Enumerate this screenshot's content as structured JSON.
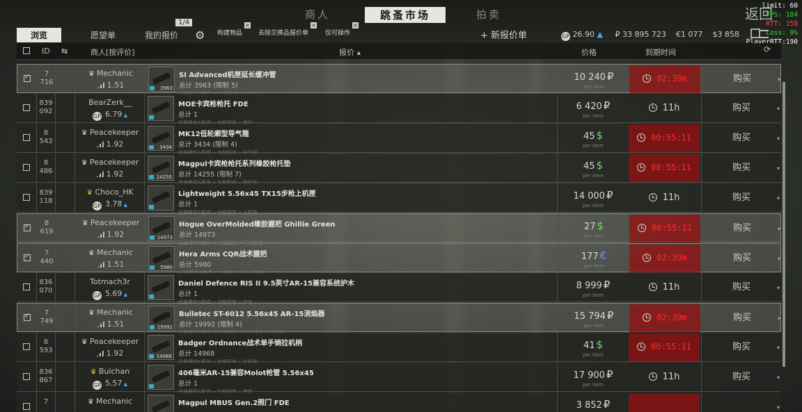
{
  "tabs": {
    "traders": "商人",
    "flea": "跳蚤市场",
    "auction": "拍卖"
  },
  "back": "返回",
  "debug": {
    "limit": "limit: 60",
    "fps": "FPS: 184",
    "rtt": "RTT: 158",
    "loss": "Loss: 0%",
    "player": "PlayerRTT:190"
  },
  "subtabs": {
    "browse": "浏览",
    "wishlist": "愿望单",
    "myoffers": "我的报价",
    "page": "1/4"
  },
  "filters": {
    "build": "构建物品",
    "barter": "去除交换品报价单",
    "only": "仅可操作"
  },
  "add_offer": "+ 新报价单",
  "currency": {
    "gp": "26.90",
    "rub": "₽ 33 895 723",
    "eur": "€1 077",
    "usd": "$3 858"
  },
  "header": {
    "id": "ID",
    "seller": "商人[按评价]",
    "offer": "报价",
    "price": "价格",
    "expires": "到期时间"
  },
  "rows": [
    {
      "selected": true,
      "checked": true,
      "id1": "7",
      "id2": "716",
      "seller": "Mechanic",
      "icon": "trader",
      "rating": "1.51",
      "item": "SI Advanced机匣延长缓冲管",
      "total": "总计 3963 (限制 5)",
      "cat": "武器零件&配件 » 功能配件 » 枪机机匣",
      "qty": "3963",
      "price": "10 240",
      "cur": "rub",
      "per": "per item",
      "time": "02:39m",
      "expiring": true,
      "buy": "购买"
    },
    {
      "selected": false,
      "checked": false,
      "id1": "839",
      "id2": "092",
      "seller": "BearZerk__",
      "icon": "gp",
      "rating": "6.79",
      "up": true,
      "item": "MOE卡宾枪枪托 FDE",
      "total": "总计 1",
      "cat": "武器零件&配件 » 功能配件 » 枪托",
      "qty": "",
      "price": "6 420",
      "cur": "rub",
      "per": "per item",
      "time": "11h",
      "expiring": false,
      "buy": "购买"
    },
    {
      "selected": false,
      "checked": false,
      "id1": "8",
      "id2": "543",
      "seller": "Peacekeeper",
      "icon": "trader",
      "rating": "1.92",
      "item": "MK12低轮廓型导气箍",
      "total": "总计 3434 (限制 4)",
      "cat": "武器零件&配件 » 功能配件 » 导气箍",
      "qty": "3434",
      "price": "45",
      "cur": "usd",
      "per": "per item",
      "time": "00:55:11",
      "expiring": true,
      "buy": "购买"
    },
    {
      "selected": false,
      "checked": false,
      "id1": "8",
      "id2": "486",
      "seller": "Peacekeeper",
      "icon": "trader",
      "rating": "1.92",
      "item": "Magpul卡宾枪枪托系列橡胶枪托垫",
      "total": "总计 14255 (限制 7)",
      "cat": "武器零件&配件 » 功能配件 » 枪托垫",
      "qty": "14255",
      "price": "45",
      "cur": "usd",
      "per": "per item",
      "time": "00:55:11",
      "expiring": true,
      "buy": "购买"
    },
    {
      "selected": false,
      "checked": false,
      "id1": "839",
      "id2": "118",
      "seller": "Choco_HK",
      "icon": "gp",
      "crown": true,
      "rating": "3.78",
      "up": true,
      "item": "Lightweight 5.56x45 TX15步枪上机匣",
      "total": "总计 1",
      "cat": "武器零件&配件 » 功能配件 » 上机匣",
      "qty": "",
      "price": "14 000",
      "cur": "rub",
      "per": "per item",
      "time": "11h",
      "expiring": false,
      "buy": "购买"
    },
    {
      "selected": true,
      "checked": true,
      "id1": "8",
      "id2": "619",
      "seller": "Peacekeeper",
      "icon": "trader",
      "rating": "1.92",
      "item": "Hogue OverMolded橡胶握把 Ghillie Green",
      "total": "总计 14973",
      "cat": "武器零件&配件 » 功能配件 » 手枪握把",
      "qty": "14973",
      "price": "27",
      "cur": "usd",
      "per": "per item",
      "time": "00:55:11",
      "expiring": true,
      "buy": "购买"
    },
    {
      "selected": true,
      "checked": true,
      "id1": "7",
      "id2": "440",
      "seller": "Mechanic",
      "icon": "trader",
      "rating": "1.51",
      "item": "Hera Arms CQR战术握把",
      "total": "总计 5980",
      "cat": "武器零件&配件 » 功能配件 » 战术握把",
      "qty": "5980",
      "price": "177",
      "cur": "eur",
      "per": "per item",
      "time": "02:39m",
      "expiring": true,
      "buy": "购买"
    },
    {
      "selected": false,
      "checked": false,
      "id1": "836",
      "id2": "070",
      "seller": "Totmach3r",
      "icon": "gp",
      "rating": "5.69",
      "up": true,
      "item": "Daniel Defence RIS II 9.5英寸AR-15兼容系统护木",
      "total": "总计 1",
      "cat": "武器零件&配件 » 功能配件 » 护木",
      "qty": "",
      "price": "8 999",
      "cur": "rub",
      "per": "per item",
      "time": "11h",
      "expiring": false,
      "buy": "购买"
    },
    {
      "selected": true,
      "checked": true,
      "id1": "7",
      "id2": "749",
      "seller": "Mechanic",
      "icon": "trader",
      "rating": "1.51",
      "item": "Bulletec ST-6012 5.56x45 AR-15消焰器",
      "total": "总计 19992 (限制 4)",
      "cat": "武器零件&配件 » 功能配件 » 枪口装置 » 消焰器",
      "qty": "19992",
      "price": "15 794",
      "cur": "rub",
      "per": "per item",
      "time": "02:39m",
      "expiring": true,
      "buy": "购买"
    },
    {
      "selected": false,
      "checked": false,
      "id1": "8",
      "id2": "593",
      "seller": "Peacekeeper",
      "icon": "trader",
      "rating": "1.92",
      "item": "Badger Ordnance战术单手销拉机柄",
      "total": "总计 14968",
      "cat": "武器零件&配件 » 功能配件 » 拉机柄",
      "qty": "14968",
      "price": "41",
      "cur": "usd",
      "per": "per item",
      "time": "00:55:11",
      "expiring": true,
      "buy": "购买"
    },
    {
      "selected": false,
      "checked": false,
      "id1": "836",
      "id2": "867",
      "seller": "Bulchan",
      "icon": "gp",
      "crown": true,
      "rating": "5.57",
      "up": true,
      "item": "406毫米AR-15兼容Molot枪管 5.56x45",
      "total": "总计 1",
      "cat": "武器零件&配件 » 功能配件 » 枪管",
      "qty": "",
      "price": "17 900",
      "cur": "rub",
      "per": "per item",
      "time": "11h",
      "expiring": false,
      "buy": "购买"
    },
    {
      "selected": false,
      "checked": false,
      "id1": "7",
      "id2": "",
      "seller": "Mechanic",
      "icon": "trader",
      "rating": "",
      "item": "Magpul MBUS Gen.2照门 FDE",
      "total": "",
      "cat": "",
      "qty": "",
      "price": "3 852",
      "cur": "rub",
      "per": "",
      "time": "",
      "expiring": true,
      "buy": ""
    }
  ]
}
